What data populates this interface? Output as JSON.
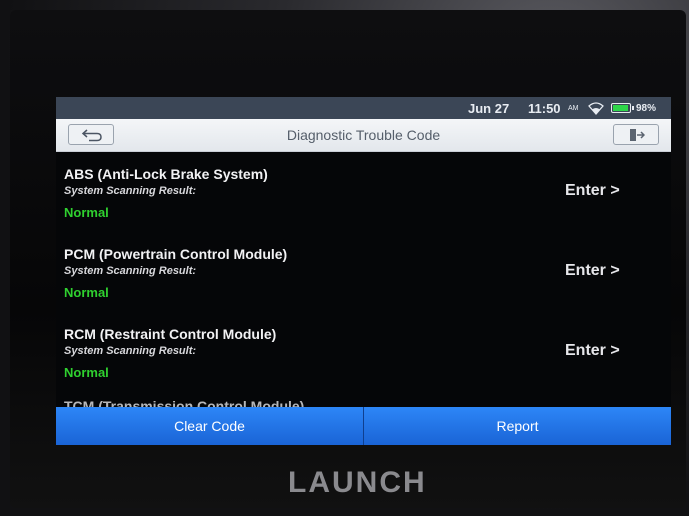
{
  "status_bar": {
    "date": "Jun 27",
    "time": "11:50",
    "ampm": "AM",
    "battery": "98%",
    "icons": [
      "wifi-icon",
      "battery-icon"
    ]
  },
  "title_bar": {
    "title": "Diagnostic Trouble Code",
    "back_icon": "back-arrow-icon",
    "exit_icon": "exit-icon"
  },
  "modules": [
    {
      "name": "ABS (Anti-Lock Brake System)",
      "label": "System Scanning Result:",
      "status": "Normal",
      "action": "Enter >"
    },
    {
      "name": "PCM (Powertrain Control Module)",
      "label": "System Scanning Result:",
      "status": "Normal",
      "action": "Enter >"
    },
    {
      "name": "RCM (Restraint Control Module)",
      "label": "System Scanning Result:",
      "status": "Normal",
      "action": "Enter >"
    },
    {
      "name": "TCM (Transmission Control Module)"
    }
  ],
  "bottom_bar": {
    "clear_label": "Clear Code",
    "report_label": "Report"
  },
  "brand": "LAUNCH",
  "colors": {
    "status_normal": "#2fd02f",
    "button_blue": "#1f73e6",
    "status_bar_bg": "#3b4656"
  }
}
